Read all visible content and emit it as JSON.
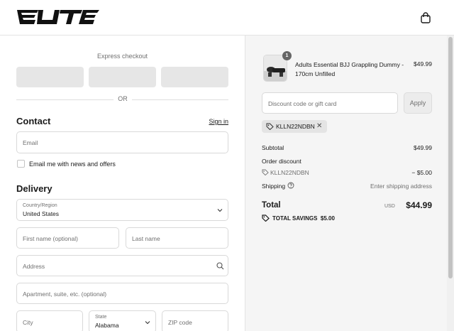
{
  "header": {
    "logo_text": "ELITE",
    "cart_icon": "shopping-bag-icon"
  },
  "express": {
    "title": "Express checkout",
    "buttons": [
      "",
      "",
      ""
    ],
    "divider_text": "OR"
  },
  "contact": {
    "heading": "Contact",
    "signin_label": "Sign in",
    "email_placeholder": "Email",
    "newsletter_label": "Email me with news and offers"
  },
  "delivery": {
    "heading": "Delivery",
    "country_label": "Country/Region",
    "country_value": "United States",
    "first_name_placeholder": "First name (optional)",
    "last_name_placeholder": "Last name",
    "address_placeholder": "Address",
    "apartment_placeholder": "Apartment, suite, etc. (optional)",
    "city_placeholder": "City",
    "state_label": "State",
    "state_value": "Alabama",
    "zip_placeholder": "ZIP code"
  },
  "summary": {
    "product": {
      "quantity": "1",
      "name": "Adults Essential BJJ Grappling Dummy - 170cm Unfilled",
      "price": "$49.99"
    },
    "discount_placeholder": "Discount code or gift card",
    "apply_label": "Apply",
    "applied_code": "KLLN22NDBN",
    "subtotal_label": "Subtotal",
    "subtotal_value": "$49.99",
    "order_discount_label": "Order discount",
    "order_discount_code": "KLLN22NDBN",
    "order_discount_value": "− $5.00",
    "shipping_label": "Shipping",
    "shipping_value": "Enter shipping address",
    "total_label": "Total",
    "currency": "USD",
    "total_value": "$44.99",
    "savings_label": "TOTAL SAVINGS",
    "savings_value": "$5.00"
  },
  "colors": {
    "panel_bg": "#f5f5f5",
    "border": "#d9d9d9",
    "muted_text": "#707070",
    "button_placeholder": "#e6e6e6"
  }
}
